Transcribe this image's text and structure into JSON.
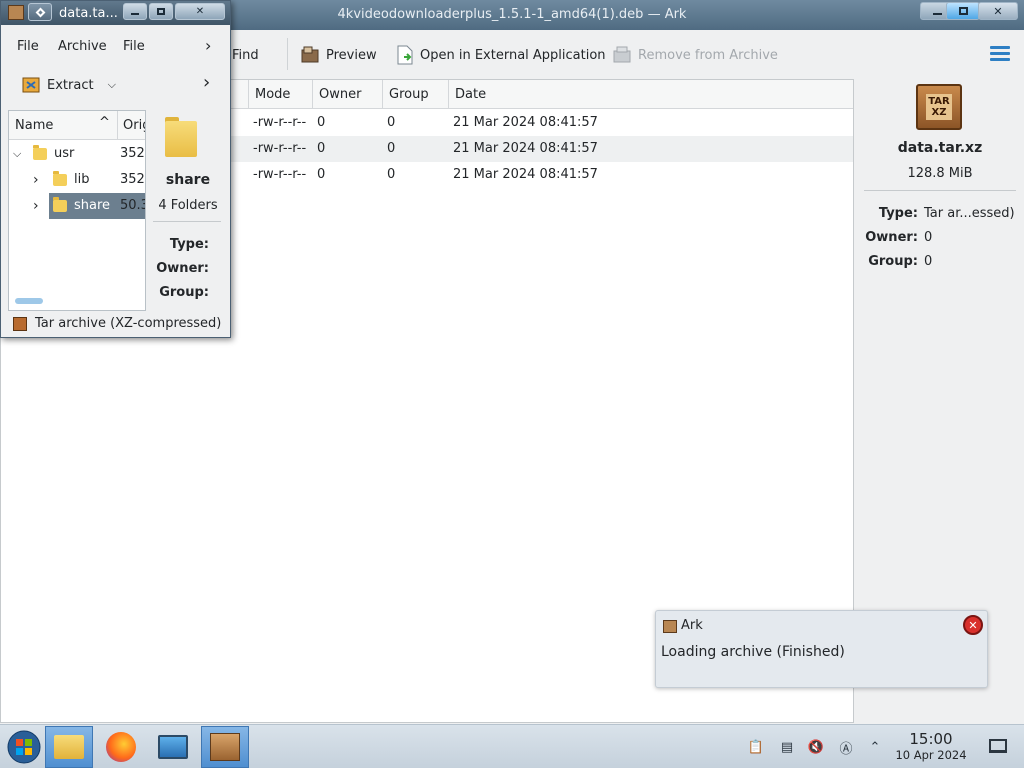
{
  "main_window": {
    "title": "4kvideodownloaderplus_1.5.1-1_amd64(1).deb — Ark",
    "toolbar": {
      "find": "Find",
      "preview": "Preview",
      "open_external": "Open in External Application",
      "remove": "Remove from Archive"
    },
    "table": {
      "columns": [
        "Mode",
        "Owner",
        "Group",
        "Date"
      ],
      "rows": [
        {
          "mode": "-rw-r--r--",
          "owner": "0",
          "group": "0",
          "date": "21 Mar 2024 08:41:57"
        },
        {
          "mode": "-rw-r--r--",
          "owner": "0",
          "group": "0",
          "date": "21 Mar 2024 08:41:57"
        },
        {
          "mode": "-rw-r--r--",
          "owner": "0",
          "group": "0",
          "date": "21 Mar 2024 08:41:57"
        }
      ]
    },
    "details": {
      "icon_text": "TAR XZ",
      "filename": "data.tar.xz",
      "size": "128.8 MiB",
      "type_label": "Type:",
      "type_value": "Tar ar...essed)",
      "owner_label": "Owner:",
      "owner_value": "0",
      "group_label": "Group:",
      "group_value": "0"
    }
  },
  "small_window": {
    "title": "data.ta...",
    "menu": {
      "file": "File",
      "archive": "Archive",
      "file2": "File"
    },
    "extract": "Extract",
    "tree": {
      "header_name": "Name",
      "header_orig": "Orig",
      "rows": [
        {
          "name": "usr",
          "size": "352."
        },
        {
          "name": "lib",
          "size": "352."
        },
        {
          "name": "share",
          "size": "50.3"
        }
      ]
    },
    "details": {
      "name": "share",
      "count": "4 Folders",
      "type_label": "Type:",
      "owner_label": "Owner:",
      "group_label": "Group:"
    },
    "status": "Tar archive (XZ-compressed)"
  },
  "notification": {
    "app": "Ark",
    "message": "Loading archive (Finished)"
  },
  "taskbar": {
    "time": "15:00",
    "date": "10 Apr 2024"
  },
  "colors": {
    "accent": "#2d7fc4",
    "selection": "#6c7f8f",
    "close_red": "#d9302c"
  }
}
